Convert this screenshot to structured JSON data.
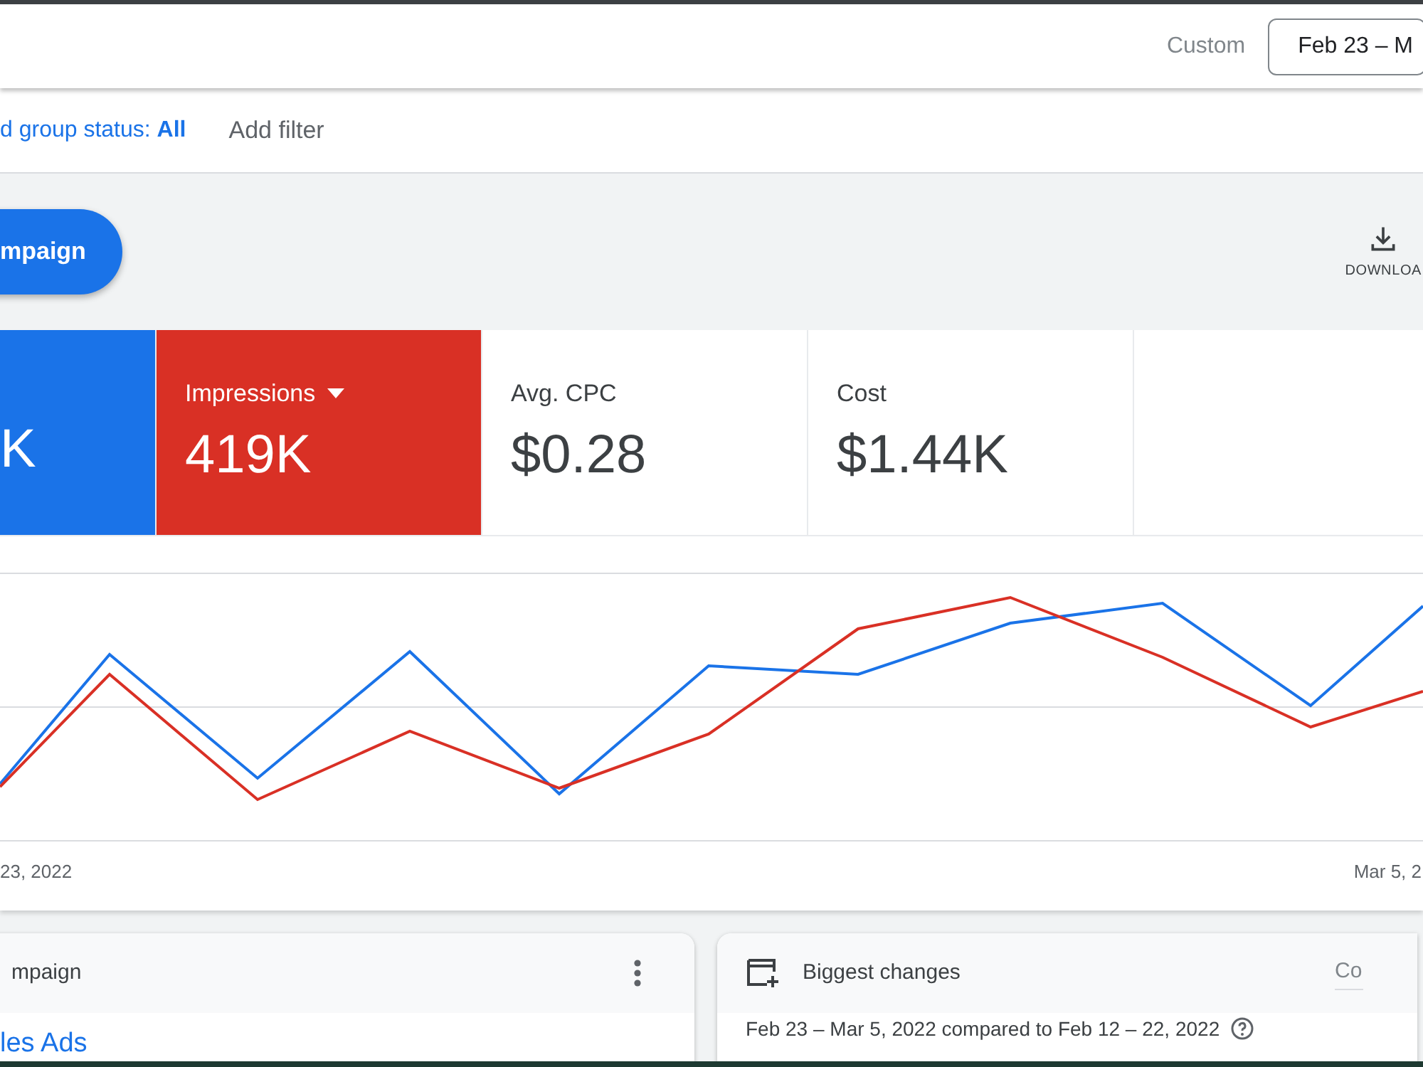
{
  "header": {
    "range_label": "Custom",
    "date_button": "Feb 23 – M"
  },
  "filters": {
    "status_filter": "d group status: **All**",
    "add_filter": "Add filter"
  },
  "toolbar": {
    "new_button": "mpaign",
    "download": "DOWNLOA"
  },
  "metrics": [
    {
      "value": "K",
      "selected": true,
      "color": "#1a73e8",
      "dropdown": false
    },
    {
      "label": "Impressions",
      "value": "419K",
      "selected": true,
      "color": "#d93025",
      "dropdown": true
    },
    {
      "label": "Avg. CPC",
      "value": "$0.28",
      "selected": false,
      "color": "#ffffff",
      "dropdown": false
    },
    {
      "label": "Cost",
      "value": "$1.44K",
      "selected": false,
      "color": "#ffffff",
      "dropdown": false
    }
  ],
  "chart": {
    "x_start": "23, 2022",
    "x_end": "Mar 5, 2"
  },
  "cards": [
    {
      "title": "mpaign",
      "link": "les Ads"
    },
    {
      "title": "Biggest changes",
      "field": "Co",
      "body": "Feb 23 – Mar 5, 2022 compared to Feb 12 – 22, 2022"
    }
  ]
}
